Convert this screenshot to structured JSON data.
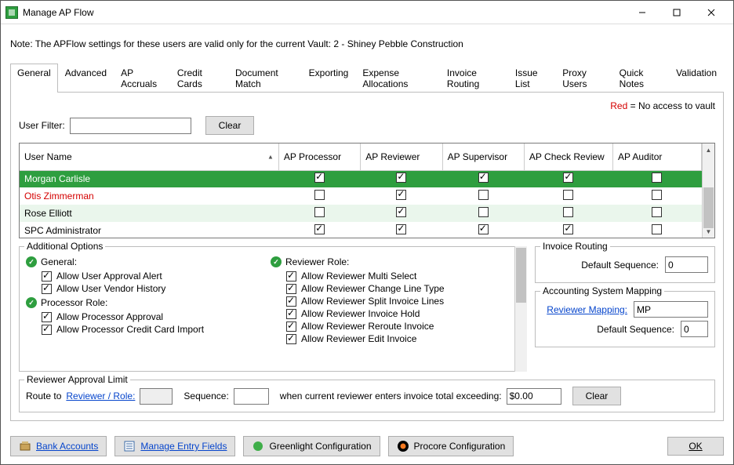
{
  "window": {
    "title": "Manage AP Flow"
  },
  "note": "Note:  The APFlow settings for these users are valid only for the current Vault: 2 - Shiney Pebble Construction",
  "tabs": [
    {
      "label": "General"
    },
    {
      "label": "Advanced"
    },
    {
      "label": "AP Accruals"
    },
    {
      "label": "Credit Cards"
    },
    {
      "label": "Document Match"
    },
    {
      "label": "Exporting"
    },
    {
      "label": "Expense Allocations"
    },
    {
      "label": "Invoice Routing"
    },
    {
      "label": "Issue List"
    },
    {
      "label": "Proxy Users"
    },
    {
      "label": "Quick Notes"
    },
    {
      "label": "Validation"
    }
  ],
  "active_tab": 0,
  "red_note": {
    "red_word": "Red",
    "rest": " = No access to vault"
  },
  "filter": {
    "label": "User Filter:",
    "value": "",
    "clear": "Clear"
  },
  "grid": {
    "columns": [
      "User Name",
      "AP Processor",
      "AP Reviewer",
      "AP Supervisor",
      "AP Check Review",
      "AP Auditor"
    ],
    "rows": [
      {
        "name": "Morgan Carlisle",
        "selected": true,
        "noaccess": false,
        "cells": [
          true,
          true,
          true,
          true,
          false
        ]
      },
      {
        "name": "Otis Zimmerman",
        "selected": false,
        "noaccess": true,
        "cells": [
          false,
          true,
          false,
          false,
          false
        ]
      },
      {
        "name": "Rose Elliott",
        "selected": false,
        "noaccess": false,
        "alt": true,
        "cells": [
          false,
          true,
          false,
          false,
          false
        ]
      },
      {
        "name": "SPC Administrator",
        "selected": false,
        "noaccess": false,
        "cells": [
          true,
          true,
          true,
          true,
          false
        ]
      }
    ]
  },
  "additional_options": {
    "legend": "Additional Options",
    "sections": [
      {
        "title": "General:",
        "opts": [
          {
            "label": "Allow User Approval Alert",
            "checked": true
          },
          {
            "label": "Allow User Vendor History",
            "checked": true
          }
        ]
      },
      {
        "title": "Processor Role:",
        "opts": [
          {
            "label": "Allow Processor Approval",
            "checked": true
          },
          {
            "label": "Allow Processor Credit Card Import",
            "checked": true
          }
        ]
      },
      {
        "title": "Reviewer Role:",
        "opts": [
          {
            "label": "Allow Reviewer Multi Select",
            "checked": true
          },
          {
            "label": "Allow Reviewer Change Line Type",
            "checked": true
          },
          {
            "label": "Allow Reviewer Split Invoice Lines",
            "checked": true
          },
          {
            "label": "Allow Reviewer Invoice Hold",
            "checked": true
          },
          {
            "label": "Allow Reviewer Reroute Invoice",
            "checked": true
          },
          {
            "label": "Allow Reviewer Edit Invoice",
            "checked": true
          }
        ]
      }
    ]
  },
  "invoice_routing": {
    "legend": "Invoice Routing",
    "default_seq_label": "Default Sequence:",
    "default_seq_value": "0"
  },
  "accounting_mapping": {
    "legend": "Accounting System Mapping",
    "reviewer_mapping_label": "Reviewer Mapping:",
    "reviewer_mapping_value": "MP",
    "default_seq_label": "Default Sequence:",
    "default_seq_value": "0"
  },
  "reviewer_limit": {
    "legend": "Reviewer Approval Limit",
    "route_to": "Route to",
    "reviewer_role": "Reviewer / Role:",
    "role_value": "",
    "sequence_label": "Sequence:",
    "sequence_value": "",
    "when_text": "when current reviewer enters invoice total exceeding:",
    "amount": "$0.00",
    "clear": "Clear"
  },
  "footer": {
    "bank_accounts": "Bank Accounts",
    "manage_entry_fields": "Manage Entry Fields",
    "greenlight": "Greenlight Configuration",
    "procore": "Procore Configuration",
    "ok": "OK"
  }
}
